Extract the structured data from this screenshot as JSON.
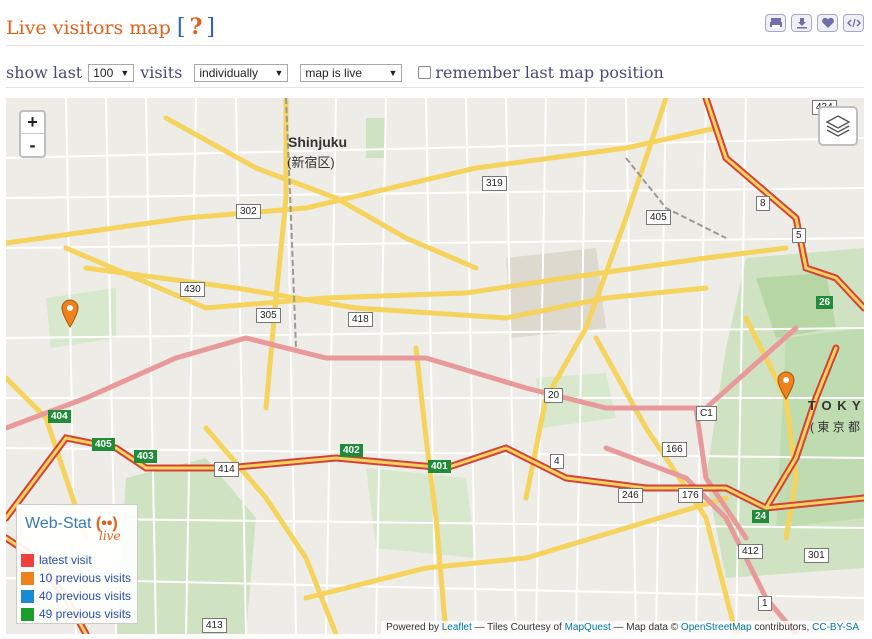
{
  "header": {
    "title": "Live visitors map",
    "help_open": "[",
    "help_mark": "?",
    "help_close": "]",
    "tools": [
      {
        "name": "print-icon"
      },
      {
        "name": "download-icon"
      },
      {
        "name": "heart-icon"
      },
      {
        "name": "embed-code-icon"
      }
    ]
  },
  "controls": {
    "show_last_label": "show last",
    "count_value": "100",
    "visits_label": "visits",
    "mode_value": "individually",
    "status_value": "map is live",
    "remember_label": "remember last map position",
    "remember_checked": false
  },
  "map": {
    "zoom_in": "+",
    "zoom_out": "-",
    "labels": {
      "shinjuku": "Shinjuku",
      "shinjuku_jp": "(新宿区)",
      "tokyo": "T O K Y",
      "tokyo_jp": "( 東 京 都"
    },
    "route_numbers": [
      "319",
      "302",
      "430",
      "305",
      "418",
      "405",
      "8",
      "5",
      "20",
      "C1",
      "166",
      "4",
      "246",
      "176",
      "414",
      "412",
      "301",
      "413",
      "1",
      "434"
    ],
    "expressway_numbers": [
      "404",
      "405",
      "403",
      "402",
      "401",
      "24",
      "26"
    ],
    "markers": [
      {
        "color": "#f0821e",
        "label": "visitor-marker-west"
      },
      {
        "color": "#f0821e",
        "label": "visitor-marker-east"
      }
    ]
  },
  "legend": {
    "brand": "Web-Stat",
    "brand_icon": "(••)",
    "live": "live",
    "items": [
      {
        "label": "latest visit",
        "color": "#f04040"
      },
      {
        "label": "10 previous visits",
        "color": "#f0821e"
      },
      {
        "label": "40 previous visits",
        "color": "#1a8ad4"
      },
      {
        "label": "49 previous visits",
        "color": "#1aa02a"
      }
    ]
  },
  "attribution": {
    "powered": "Powered by",
    "leaflet": "Leaflet",
    "tiles": "— Tiles Courtesy of",
    "mapquest": "MapQuest",
    "mapdata": "— Map data ©",
    "osm": "OpenStreetMap",
    "contributors": "contributors,",
    "license": "CC-BY-SA"
  }
}
